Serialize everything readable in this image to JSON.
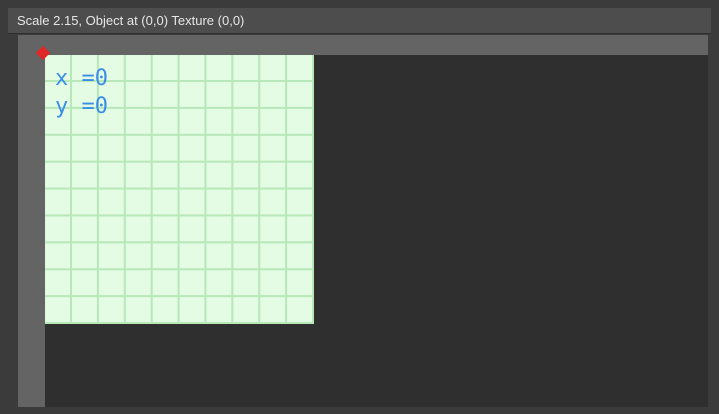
{
  "title_bar": {
    "text": "Scale 2.15, Object at (0,0) Texture (0,0)"
  },
  "texture": {
    "x_readout": "x =0",
    "y_readout": "y =0"
  },
  "colors": {
    "texture_fill": "#e4fbe4",
    "grid_line": "#b7e8b7",
    "readout_text": "#3a8ee8",
    "origin_marker": "#e02828",
    "ruler": "#646464",
    "viewport_bg": "#2f2f2f"
  },
  "icons": {
    "origin": "origin-marker-diamond"
  }
}
